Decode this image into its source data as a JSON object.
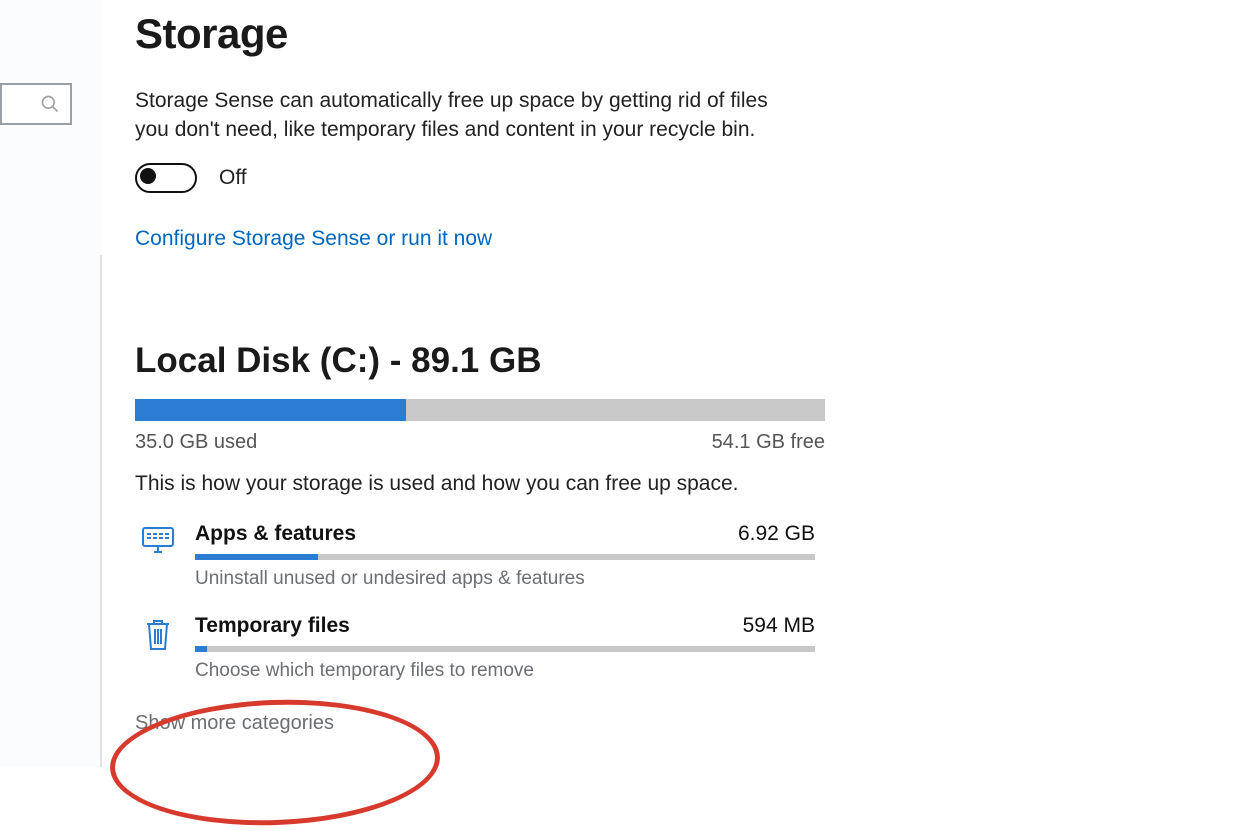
{
  "page": {
    "title": "Storage",
    "description": "Storage Sense can automatically free up space by getting rid of files you don't need, like temporary files and content in your recycle bin.",
    "toggle_state": "Off",
    "configure_link": "Configure Storage Sense or run it now"
  },
  "disk": {
    "header": "Local Disk (C:) - 89.1 GB",
    "used_label": "35.0 GB used",
    "free_label": "54.1 GB free",
    "used_pct": 39.3,
    "hint": "This is how your storage is used and how you can free up space."
  },
  "categories": [
    {
      "icon": "monitor-keyboard-icon",
      "title": "Apps & features",
      "size": "6.92 GB",
      "pct": 19.8,
      "sub": "Uninstall unused or undesired apps & features"
    },
    {
      "icon": "trash-icon",
      "title": "Temporary files",
      "size": "594 MB",
      "pct": 2,
      "sub": "Choose which temporary files to remove"
    }
  ],
  "show_more": "Show more categories",
  "colors": {
    "accent": "#2b7cd3",
    "link": "#0067c0",
    "bar_bg": "#c8c8c8",
    "annotation": "#d73a2c"
  }
}
